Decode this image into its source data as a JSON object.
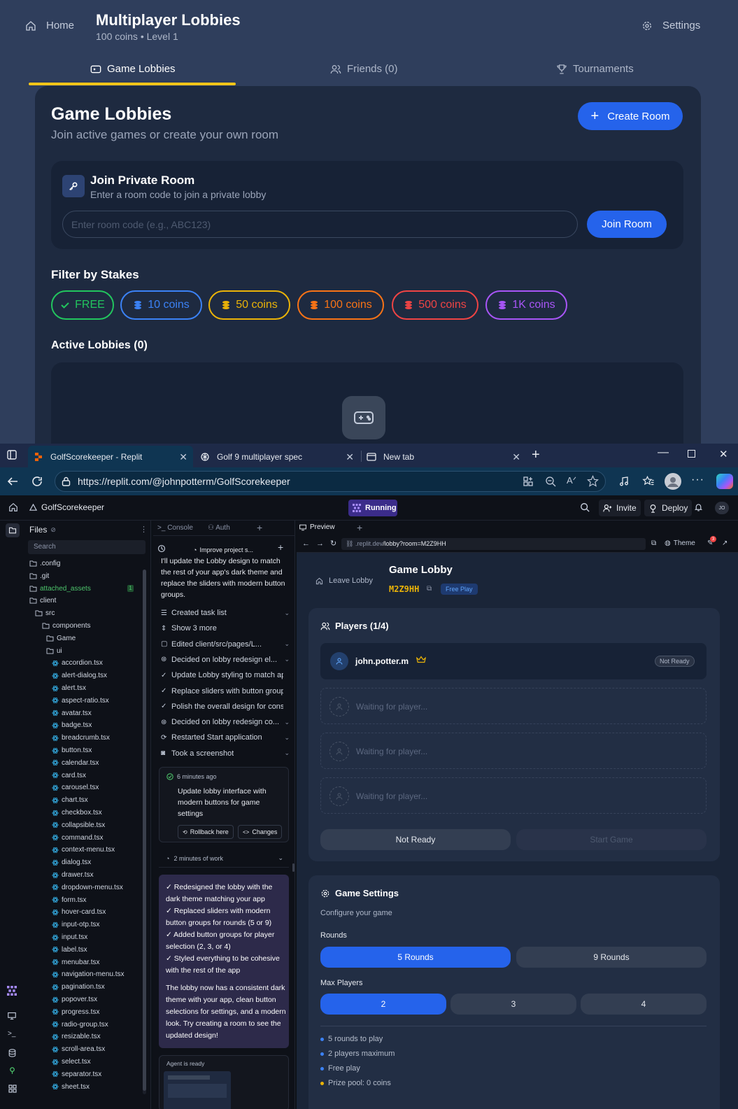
{
  "app": {
    "home_label": "Home",
    "title": "Multiplayer Lobbies",
    "subtitle": "100 coins • Level 1",
    "settings_label": "Settings",
    "tabs": [
      {
        "label": "Game Lobbies"
      },
      {
        "label": "Friends (0)"
      },
      {
        "label": "Tournaments"
      }
    ],
    "panel": {
      "title": "Game Lobbies",
      "subtitle": "Join active games or create your own room",
      "create_label": "Create Room",
      "join": {
        "title": "Join Private Room",
        "subtitle": "Enter a room code to join a private lobby",
        "placeholder": "Enter room code (e.g., ABC123)",
        "button": "Join Room"
      },
      "filter_title": "Filter by Stakes",
      "stakes": [
        {
          "label": "FREE",
          "color": "#22c55e"
        },
        {
          "label": "10 coins",
          "color": "#3b82f6"
        },
        {
          "label": "50 coins",
          "color": "#eab308"
        },
        {
          "label": "100 coins",
          "color": "#f97316"
        },
        {
          "label": "500 coins",
          "color": "#ef4444"
        },
        {
          "label": "1K coins",
          "color": "#a855f7"
        }
      ],
      "active_title": "Active Lobbies (0)"
    }
  },
  "browser": {
    "tabs": [
      {
        "label": "GolfScorekeeper - Replit"
      },
      {
        "label": "Golf 9 multiplayer spec"
      },
      {
        "label": "New tab"
      }
    ],
    "url": "https://replit.com/@johnpotterm/GolfScorekeeper"
  },
  "replit": {
    "project": "GolfScorekeeper",
    "status": "Running",
    "invite": "Invite",
    "deploy": "Deploy",
    "avatar": "JO",
    "files": {
      "title": "Files",
      "search": "Search",
      "attached_count": "1",
      "items": [
        {
          "name": ".config",
          "type": "folder",
          "depth": 0
        },
        {
          "name": ".git",
          "type": "folder",
          "depth": 0
        },
        {
          "name": "attached_assets",
          "type": "folder",
          "depth": 0,
          "highlight": true
        },
        {
          "name": "client",
          "type": "folder",
          "depth": 0
        },
        {
          "name": "src",
          "type": "folder",
          "depth": 1
        },
        {
          "name": "components",
          "type": "folder",
          "depth": 2
        },
        {
          "name": "Game",
          "type": "folder",
          "depth": 3
        },
        {
          "name": "ui",
          "type": "folder",
          "depth": 3
        },
        {
          "name": "accordion.tsx",
          "type": "file",
          "depth": 4
        },
        {
          "name": "alert-dialog.tsx",
          "type": "file",
          "depth": 4
        },
        {
          "name": "alert.tsx",
          "type": "file",
          "depth": 4
        },
        {
          "name": "aspect-ratio.tsx",
          "type": "file",
          "depth": 4
        },
        {
          "name": "avatar.tsx",
          "type": "file",
          "depth": 4
        },
        {
          "name": "badge.tsx",
          "type": "file",
          "depth": 4
        },
        {
          "name": "breadcrumb.tsx",
          "type": "file",
          "depth": 4
        },
        {
          "name": "button.tsx",
          "type": "file",
          "depth": 4
        },
        {
          "name": "calendar.tsx",
          "type": "file",
          "depth": 4
        },
        {
          "name": "card.tsx",
          "type": "file",
          "depth": 4
        },
        {
          "name": "carousel.tsx",
          "type": "file",
          "depth": 4
        },
        {
          "name": "chart.tsx",
          "type": "file",
          "depth": 4
        },
        {
          "name": "checkbox.tsx",
          "type": "file",
          "depth": 4
        },
        {
          "name": "collapsible.tsx",
          "type": "file",
          "depth": 4
        },
        {
          "name": "command.tsx",
          "type": "file",
          "depth": 4
        },
        {
          "name": "context-menu.tsx",
          "type": "file",
          "depth": 4
        },
        {
          "name": "dialog.tsx",
          "type": "file",
          "depth": 4
        },
        {
          "name": "drawer.tsx",
          "type": "file",
          "depth": 4
        },
        {
          "name": "dropdown-menu.tsx",
          "type": "file",
          "depth": 4
        },
        {
          "name": "form.tsx",
          "type": "file",
          "depth": 4
        },
        {
          "name": "hover-card.tsx",
          "type": "file",
          "depth": 4
        },
        {
          "name": "input-otp.tsx",
          "type": "file",
          "depth": 4
        },
        {
          "name": "input.tsx",
          "type": "file",
          "depth": 4
        },
        {
          "name": "label.tsx",
          "type": "file",
          "depth": 4
        },
        {
          "name": "menubar.tsx",
          "type": "file",
          "depth": 4
        },
        {
          "name": "navigation-menu.tsx",
          "type": "file",
          "depth": 4
        },
        {
          "name": "pagination.tsx",
          "type": "file",
          "depth": 4
        },
        {
          "name": "popover.tsx",
          "type": "file",
          "depth": 4
        },
        {
          "name": "progress.tsx",
          "type": "file",
          "depth": 4
        },
        {
          "name": "radio-group.tsx",
          "type": "file",
          "depth": 4
        },
        {
          "name": "resizable.tsx",
          "type": "file",
          "depth": 4
        },
        {
          "name": "scroll-area.tsx",
          "type": "file",
          "depth": 4
        },
        {
          "name": "select.tsx",
          "type": "file",
          "depth": 4
        },
        {
          "name": "separator.tsx",
          "type": "file",
          "depth": 4
        },
        {
          "name": "sheet.tsx",
          "type": "file",
          "depth": 4
        }
      ]
    },
    "chat": {
      "tab_console": "Console",
      "tab_auth": "Auth",
      "thread_title": "Improve project s...",
      "intro": "I'll update the Lobby design to match the rest of your app's dark theme and replace the sliders with modern button groups.",
      "steps": [
        {
          "icon": "list",
          "text": "Created task list"
        },
        {
          "icon": "expand",
          "text": "Show 3 more"
        },
        {
          "icon": "edit",
          "text": "Edited client/src/pages/L..."
        },
        {
          "icon": "decide",
          "text": "Decided on lobby redesign el..."
        },
        {
          "icon": "check",
          "text": "Update Lobby styling to match ap..."
        },
        {
          "icon": "check",
          "text": "Replace sliders with button group..."
        },
        {
          "icon": "check",
          "text": "Polish the overall design for consi..."
        },
        {
          "icon": "decide",
          "text": "Decided on lobby redesign co..."
        },
        {
          "icon": "restart",
          "text": "Restarted Start application"
        },
        {
          "icon": "camera",
          "text": "Took a screenshot"
        }
      ],
      "checkpoint": {
        "time": "6 minutes ago",
        "text": "Update lobby interface with modern buttons for game settings",
        "rollback": "Rollback here",
        "changes": "Changes"
      },
      "work_time": "2 minutes of work",
      "summary": [
        "✓ Redesigned the lobby with the dark theme matching your app",
        "✓ Replaced sliders with modern button groups for rounds (5 or 9)",
        "✓ Added button groups for player selection (2, 3, or 4)",
        "✓ Styled everything to be cohesive with the rest of the app"
      ],
      "closing": "The lobby now has a consistent dark theme with your app, clean button selections for settings, and a modern look. Try creating a room to see the updated design!",
      "agent_ready": "Agent is ready"
    },
    "preview": {
      "tab": "Preview",
      "url_host": ".replit.dev",
      "url_path": "/lobby?room=M2Z9HH",
      "theme_label": "Theme",
      "notif_count": "3",
      "leave": "Leave Lobby",
      "lobby_title": "Game Lobby",
      "room_code": "M2Z9HH",
      "mode_badge": "Free Play",
      "players_title": "Players (1/4)",
      "player_name": "john.potter.m",
      "player_status": "Not Ready",
      "waiting": "Waiting for player...",
      "not_ready_btn": "Not Ready",
      "start_btn": "Start Game",
      "settings_title": "Game Settings",
      "settings_sub": "Configure your game",
      "rounds_label": "Rounds",
      "rounds": [
        "5 Rounds",
        "9 Rounds"
      ],
      "max_label": "Max Players",
      "max_options": [
        "2",
        "3",
        "4"
      ],
      "summary": [
        {
          "text": "5 rounds to play",
          "color": "#3b82f6"
        },
        {
          "text": "2 players maximum",
          "color": "#3b82f6"
        },
        {
          "text": "Free play",
          "color": "#3b82f6"
        },
        {
          "text": "Prize pool: 0 coins",
          "color": "#eab308"
        }
      ]
    }
  }
}
